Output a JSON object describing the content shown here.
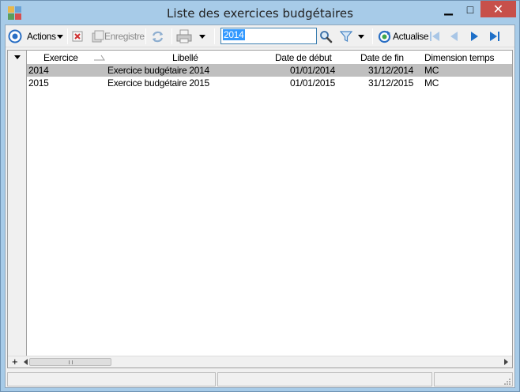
{
  "window": {
    "title": "Liste des exercices budgétaires",
    "controls": {
      "minimize": "▁",
      "maximize": "□",
      "close": "✕"
    }
  },
  "toolbar": {
    "actions_label": "Actions",
    "save_label": "Enregistre",
    "search_value": "2014",
    "refresh_label": "Actualise",
    "icons": [
      "actions-icon",
      "delete-icon",
      "save-icon",
      "sync-icon",
      "print-icon",
      "search-icon",
      "filter-icon",
      "refresh-icon",
      "first-icon",
      "prev-icon",
      "next-icon",
      "last-icon"
    ]
  },
  "grid": {
    "columns": [
      "Exercice",
      "Libellé",
      "Date de début",
      "Date de fin",
      "Dimension temps"
    ],
    "rows": [
      {
        "exercice": "2014",
        "libelle": "Exercice budgétaire 2014",
        "debut": "01/01/2014",
        "fin": "31/12/2014",
        "dimension": "MC",
        "selected": true
      },
      {
        "exercice": "2015",
        "libelle": "Exercice budgétaire 2015",
        "debut": "01/01/2015",
        "fin": "31/12/2015",
        "dimension": "MC",
        "selected": false
      }
    ],
    "add_label": "+"
  },
  "colors": {
    "title_bar": "#a7cbe8",
    "close_button": "#c7504a",
    "selected_row": "#bfbfbf",
    "accent": "#1e6fc8"
  }
}
